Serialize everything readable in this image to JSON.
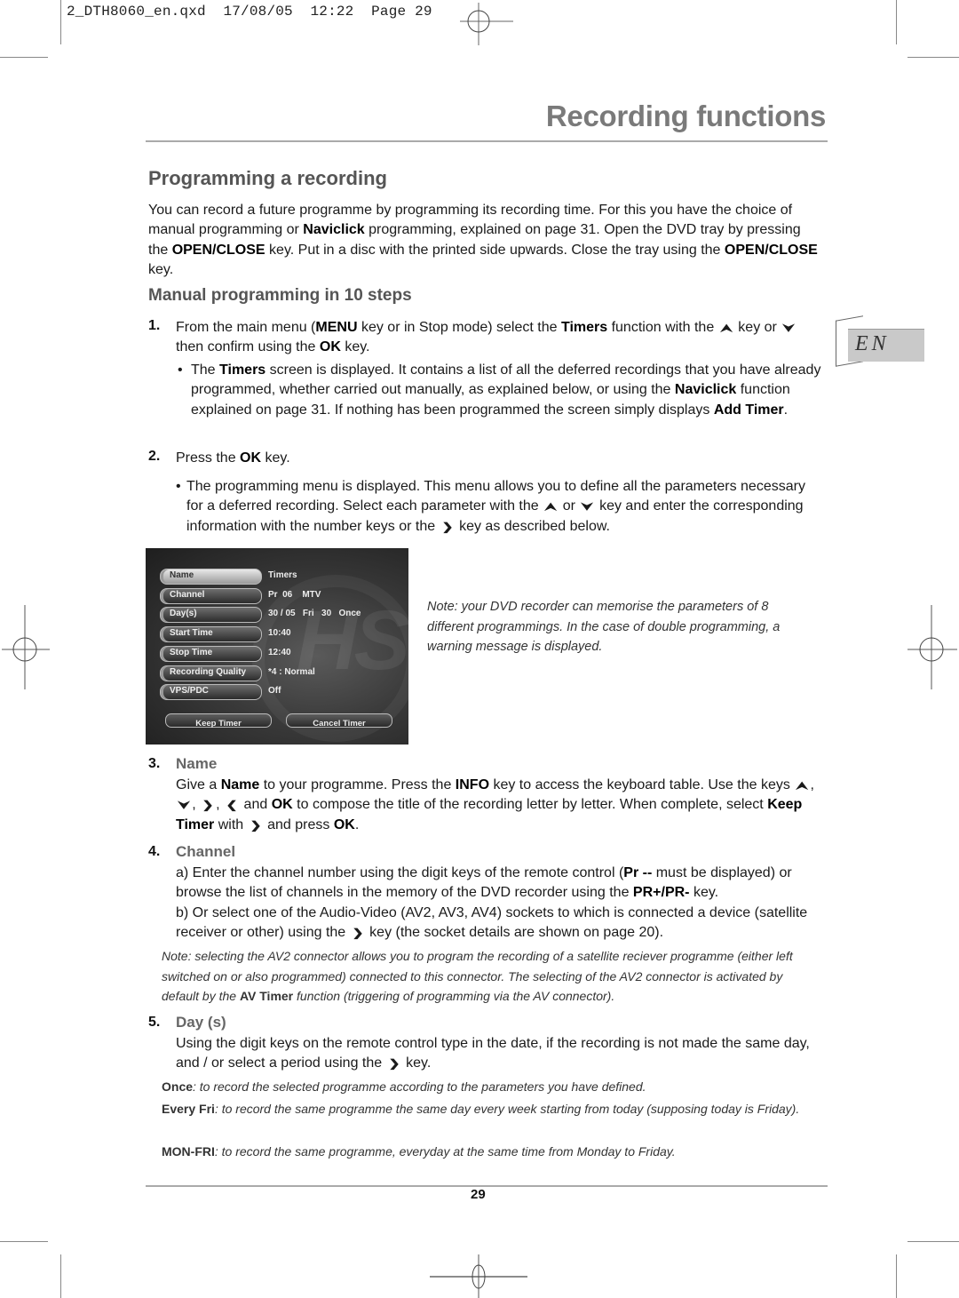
{
  "slug": {
    "file": "2_DTH8060_en.qxd",
    "date": "17/08/05",
    "time": "12:22",
    "page_label": "Page 29"
  },
  "chapter_title": "Recording functions",
  "language_tab": "EN",
  "section": {
    "title": "Programming a recording",
    "intro": [
      {
        "t": "You can record a future programme by programming its recording time. For this you have the choice of manual programming or "
      },
      {
        "b": "Naviclick"
      },
      {
        "t": " programming, explained on page 31. Open the DVD tray by pressing the "
      },
      {
        "b": "OPEN/CLOSE"
      },
      {
        "t": " key. Put in a disc with the printed side upwards. Close the tray using the "
      },
      {
        "b": "OPEN/CLOSE"
      },
      {
        "t": " key."
      }
    ],
    "subtitle": "Manual programming in 10 steps"
  },
  "steps": {
    "s1_num": "1.",
    "s1": [
      {
        "t": "From the main menu ("
      },
      {
        "b": "MENU"
      },
      {
        "t": " key or in Stop mode) select the "
      },
      {
        "b": "Timers"
      },
      {
        "t": " function with the "
      },
      {
        "icon": "up"
      },
      {
        "t": " key or "
      },
      {
        "icon": "down"
      },
      {
        "t": " then confirm using the "
      },
      {
        "b": "OK"
      },
      {
        "t": " key."
      }
    ],
    "s1_bullet": [
      {
        "t": "The "
      },
      {
        "b": "Timers"
      },
      {
        "t": " screen is displayed. It contains a list of all the deferred recordings that you have already programmed, whether carried out manually, as explained below, or using the "
      },
      {
        "b": "Naviclick"
      },
      {
        "t": " function explained on page 31. If nothing has been programmed the screen simply displays "
      },
      {
        "b": "Add Timer"
      },
      {
        "t": "."
      }
    ],
    "s2_num": "2.",
    "s2": [
      {
        "t": "Press the "
      },
      {
        "b": "OK"
      },
      {
        "t": " key."
      }
    ],
    "s2_bullet": [
      {
        "t": "The programming menu is displayed. This menu allows you to define all the parameters necessary for a deferred recording. Select each parameter with the "
      },
      {
        "icon": "up"
      },
      {
        "t": " or "
      },
      {
        "icon": "down"
      },
      {
        "t": " key and enter the corresponding information with the number keys or the "
      },
      {
        "icon": "right"
      },
      {
        "t": " key as described below."
      }
    ]
  },
  "osd": {
    "rows": [
      {
        "label": "Name",
        "value": "Timers",
        "selected": true
      },
      {
        "label": "Channel",
        "value": "Pr  06    MTV",
        "selected": false
      },
      {
        "label": "Day(s)",
        "value": "30 / 05   Fri   30   Once",
        "selected": false
      },
      {
        "label": "Start Time",
        "value": "10:40",
        "selected": false
      },
      {
        "label": "Stop Time",
        "value": "12:40",
        "selected": false
      },
      {
        "label": "Recording Quality",
        "value": "*4 : Normal",
        "selected": false
      },
      {
        "label": "VPS/PDC",
        "value": "Off",
        "selected": false
      }
    ],
    "keep_label": "Keep Timer",
    "cancel_label": "Cancel Timer"
  },
  "osd_note": "Note: your DVD recorder can memorise the parameters of 8 different programmings. In the case of double programming, a warning message is displayed.",
  "name_section": {
    "num": "3.",
    "title": "Name",
    "body": [
      {
        "t": "Give a "
      },
      {
        "b": "Name"
      },
      {
        "t": " to your programme. Press the "
      },
      {
        "b": "INFO"
      },
      {
        "t": " key to access the keyboard table. Use the keys "
      },
      {
        "icon": "up"
      },
      {
        "t": ", "
      },
      {
        "icon": "down"
      },
      {
        "t": ", "
      },
      {
        "icon": "right"
      },
      {
        "t": ", "
      },
      {
        "icon": "left"
      },
      {
        "t": " and "
      },
      {
        "b": "OK"
      },
      {
        "t": " to compose the title of the recording letter by letter. When complete, select "
      },
      {
        "b": "Keep Timer"
      },
      {
        "t": " with "
      },
      {
        "icon": "right"
      },
      {
        "t": " and press "
      },
      {
        "b": "OK"
      },
      {
        "t": "."
      }
    ]
  },
  "channel_section": {
    "num": "4.",
    "title": "Channel",
    "a": [
      {
        "t": "a) Enter the channel number using the digit keys of the remote control ("
      },
      {
        "b": "Pr --"
      },
      {
        "t": " must be displayed) or browse the list of channels in the memory of the DVD recorder using the "
      },
      {
        "b": "PR+/PR-"
      },
      {
        "t": " key."
      }
    ],
    "b": [
      {
        "t": "b) Or select one of the Audio-Video (AV2, AV3, AV4) sockets to which is connected a device (satellite receiver or other) using the "
      },
      {
        "icon": "right"
      },
      {
        "t": " key (the socket details are shown on page 20)."
      }
    ],
    "note": [
      {
        "t": "Note: selecting the AV2 connector allows you to program the recording of a satellite reciever programme (either left switched on or also programmed) connected to this connector. The selecting of the AV2 connector is activated by default by the "
      },
      {
        "b": "AV Timer"
      },
      {
        "t": " function (triggering of programming via the AV connector)."
      }
    ]
  },
  "days_section": {
    "num": "5.",
    "title": "Day (s)",
    "body": [
      {
        "t": "Using the digit keys on the remote control type in the date, if the recording is not made the same day, and / or select a period using the "
      },
      {
        "icon": "right"
      },
      {
        "t": " key."
      }
    ],
    "options": [
      [
        {
          "b": "Once"
        },
        {
          "t": ": to record the selected programme according to the parameters you have defined."
        }
      ],
      [
        {
          "b": "Every Fri"
        },
        {
          "t": ": to record the same programme the same day every week starting from today (supposing today is Friday)."
        }
      ],
      [
        {
          "b": "MON-FRI"
        },
        {
          "t": ": to record the same programme, everyday at the same time from Monday to Friday."
        }
      ]
    ]
  },
  "page_number": "29",
  "icons": {
    "up": "⮝",
    "down": "⮟",
    "right": "❯",
    "left": "❮"
  }
}
